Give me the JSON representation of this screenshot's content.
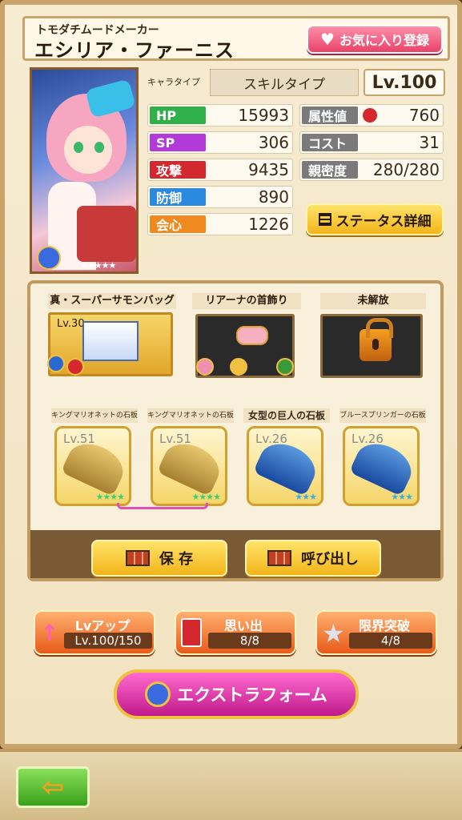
{
  "header": {
    "subtitle": "トモダチムードメーカー",
    "name": "エシリア・ファーニス",
    "favorite_label": "お気に入り登録"
  },
  "profile": {
    "type_label": "キャラタイプ",
    "type_value": "スキルタイプ",
    "level": "Lv.100",
    "stats_left": [
      {
        "label": "HP",
        "value": "15993",
        "color": "#2fb04a"
      },
      {
        "label": "SP",
        "value": "306",
        "color": "#b13ad8"
      },
      {
        "label": "攻撃",
        "value": "9435",
        "color": "#d2282e"
      },
      {
        "label": "防御",
        "value": "890",
        "color": "#2a8ae0"
      },
      {
        "label": "会心",
        "value": "1226",
        "color": "#f08a20"
      }
    ],
    "stats_right": [
      {
        "label": "属性値",
        "value": "760",
        "color": "#7a7a7a"
      },
      {
        "label": "コスト",
        "value": "31",
        "color": "#7a7a7a"
      },
      {
        "label": "親密度",
        "value": "280/280",
        "color": "#7a7a7a"
      }
    ],
    "status_detail_label": "ステータス詳細"
  },
  "equipment": {
    "slots": [
      {
        "title": "真・スーパーサモンバッグ",
        "level": "Lv.30"
      },
      {
        "title": "リアーナの首飾り"
      },
      {
        "title": "未解放"
      }
    ],
    "stones": [
      {
        "title": "キングマリオネットの石板",
        "level": "Lv.51",
        "stars": "★★★★"
      },
      {
        "title": "キングマリオネットの石板",
        "level": "Lv.51",
        "stars": "★★★★"
      },
      {
        "title": "女型の巨人の石板",
        "level": "Lv.26",
        "stars": "★★★"
      },
      {
        "title": "ブルースプリンガーの石板",
        "level": "Lv.26",
        "stars": "★★★"
      }
    ],
    "save_label": "保 存",
    "recall_label": "呼び出し"
  },
  "actions": {
    "levelup_label": "Lvアップ",
    "levelup_value": "Lv.100/150",
    "memories_label": "思い出",
    "memories_value": "8/8",
    "limit_label": "限界突破",
    "limit_value": "4/8",
    "extra_form_label": "エクストラフォーム"
  },
  "portrait": {
    "stars": "★★★★★"
  }
}
